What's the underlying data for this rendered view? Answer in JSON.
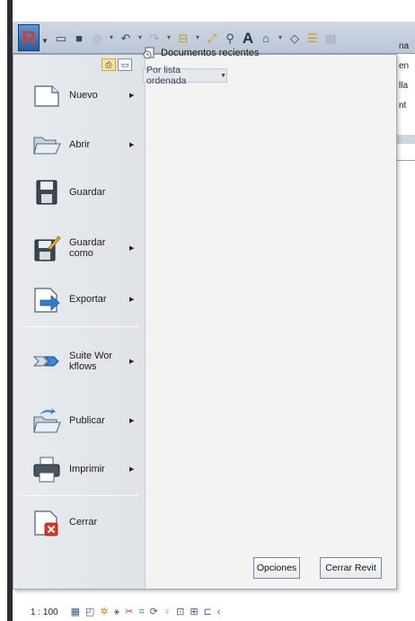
{
  "app": {
    "logo_letter": "R"
  },
  "quick_access_icons": [
    "open-folder-icon",
    "save-icon",
    "sync-icon",
    "undo-icon",
    "redo-icon",
    "measure-icon",
    "dimension-icon",
    "tag-icon",
    "text-icon",
    "3d-view-icon",
    "section-icon",
    "thin-lines-icon",
    "switch-windows-icon"
  ],
  "left_menu": {
    "items": [
      {
        "label": "Nuevo",
        "icon": "new-document-icon",
        "submenu": true
      },
      {
        "label": "Abrir",
        "icon": "open-folder-icon",
        "submenu": true
      },
      {
        "label": "Guardar",
        "icon": "save-disk-icon",
        "submenu": false
      },
      {
        "label": "Guardar como",
        "icon": "save-as-icon",
        "submenu": true
      },
      {
        "label": "Exportar",
        "icon": "export-icon",
        "submenu": true
      },
      {
        "label": "Suite Workflows",
        "icon": "suite-workflow-icon",
        "submenu": true
      },
      {
        "label": "Publicar",
        "icon": "publish-icon",
        "submenu": true
      },
      {
        "label": "Imprimir",
        "icon": "print-icon",
        "submenu": true
      },
      {
        "label": "Cerrar",
        "icon": "close-document-icon",
        "submenu": false
      }
    ]
  },
  "recent": {
    "title": "Documentos recientes",
    "sort_selected": "Por lista ordenada"
  },
  "buttons": {
    "options": "Opciones",
    "exit": "Cerrar Revit"
  },
  "background_text": [
    "na",
    "en",
    "lla",
    "nt"
  ],
  "status_bar": {
    "scale": "1 : 100"
  },
  "colors": {
    "accent_blue": "#1f5ea8",
    "revit_red": "#d93a2a",
    "panel_bg": "#f3f3f3",
    "left_col_bg": "#e2e6eb"
  }
}
